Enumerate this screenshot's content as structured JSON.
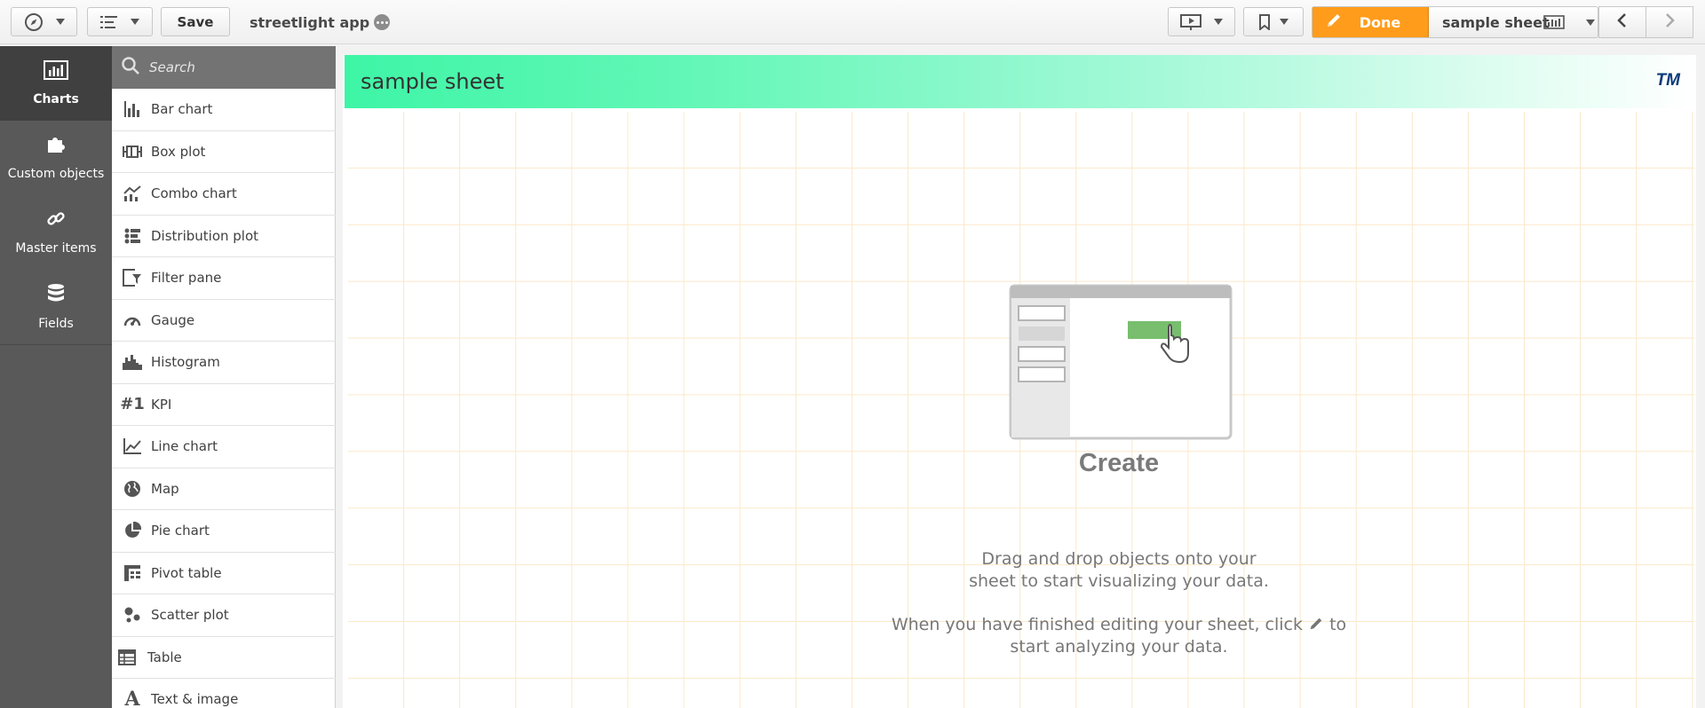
{
  "toolbar": {
    "save_label": "Save",
    "app_title": "streetlight app",
    "done_label": "Done",
    "sheet_name": "sample sheet"
  },
  "rail": {
    "items": [
      {
        "label": "Charts",
        "icon": "bar-chart-icon",
        "active": true
      },
      {
        "label": "Custom objects",
        "icon": "puzzle-icon",
        "active": false
      },
      {
        "label": "Master items",
        "icon": "link-icon",
        "active": false
      },
      {
        "label": "Fields",
        "icon": "database-icon",
        "active": false
      }
    ]
  },
  "assets": {
    "search_placeholder": "Search",
    "charts": [
      {
        "label": "Bar chart",
        "icon": "bar-chart-icon"
      },
      {
        "label": "Box plot",
        "icon": "box-plot-icon"
      },
      {
        "label": "Combo chart",
        "icon": "combo-chart-icon"
      },
      {
        "label": "Distribution plot",
        "icon": "distribution-plot-icon"
      },
      {
        "label": "Filter pane",
        "icon": "filter-pane-icon"
      },
      {
        "label": "Gauge",
        "icon": "gauge-icon"
      },
      {
        "label": "Histogram",
        "icon": "histogram-icon"
      },
      {
        "label": "KPI",
        "icon": "kpi-icon",
        "glyph": "#1"
      },
      {
        "label": "Line chart",
        "icon": "line-chart-icon"
      },
      {
        "label": "Map",
        "icon": "map-icon"
      },
      {
        "label": "Pie chart",
        "icon": "pie-chart-icon"
      },
      {
        "label": "Pivot table",
        "icon": "pivot-table-icon"
      },
      {
        "label": "Scatter plot",
        "icon": "scatter-plot-icon"
      },
      {
        "label": "Table",
        "icon": "table-icon"
      },
      {
        "label": "Text & image",
        "icon": "text-image-icon",
        "glyph": "A"
      }
    ]
  },
  "sheet": {
    "title": "sample sheet",
    "logo_text": "TM",
    "header_gradient_start": "#3ef5a6",
    "create_title": "Create",
    "create_text_1": "Drag and drop objects onto your sheet to start visualizing your data.",
    "create_text_2a": "When you have finished editing your sheet, click",
    "create_text_2b": "to start analyzing your data."
  },
  "colors": {
    "accent": "#ff9c1b",
    "rail_bg": "#595959",
    "rail_active": "#404040"
  }
}
